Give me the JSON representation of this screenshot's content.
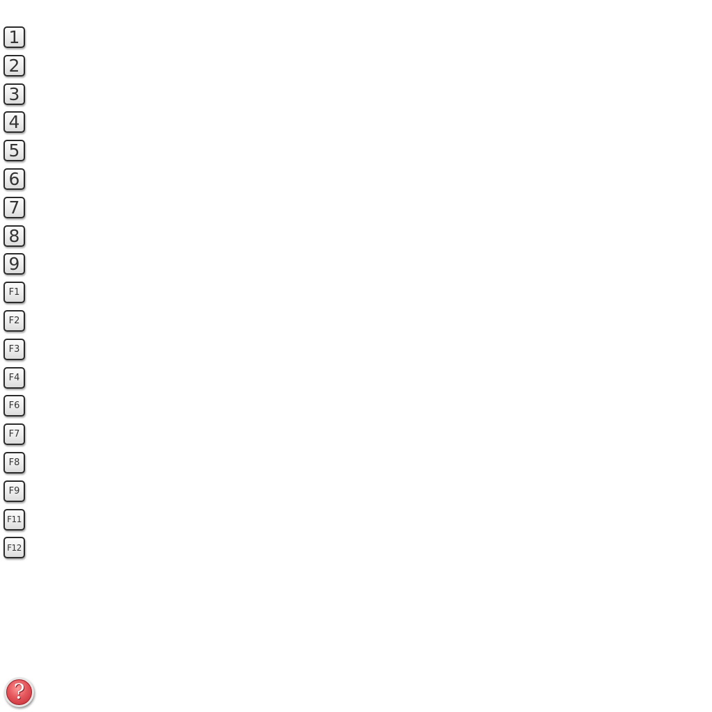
{
  "keys": [
    {
      "label": "1",
      "kind": "num"
    },
    {
      "label": "2",
      "kind": "num"
    },
    {
      "label": "3",
      "kind": "num"
    },
    {
      "label": "4",
      "kind": "num"
    },
    {
      "label": "5",
      "kind": "num"
    },
    {
      "label": "6",
      "kind": "num"
    },
    {
      "label": "7",
      "kind": "num"
    },
    {
      "label": "8",
      "kind": "num"
    },
    {
      "label": "9",
      "kind": "num"
    },
    {
      "label": "F1",
      "kind": "fn"
    },
    {
      "label": "F2",
      "kind": "fn"
    },
    {
      "label": "F3",
      "kind": "fn"
    },
    {
      "label": "F4",
      "kind": "fn"
    },
    {
      "label": "F6",
      "kind": "fn"
    },
    {
      "label": "F7",
      "kind": "fn"
    },
    {
      "label": "F8",
      "kind": "fn"
    },
    {
      "label": "F9",
      "kind": "fn"
    },
    {
      "label": "F11",
      "kind": "fn"
    },
    {
      "label": "F12",
      "kind": "fn"
    }
  ],
  "help": {
    "glyph": "?",
    "icon": "question-mark-icon",
    "color": "#d93a42"
  }
}
